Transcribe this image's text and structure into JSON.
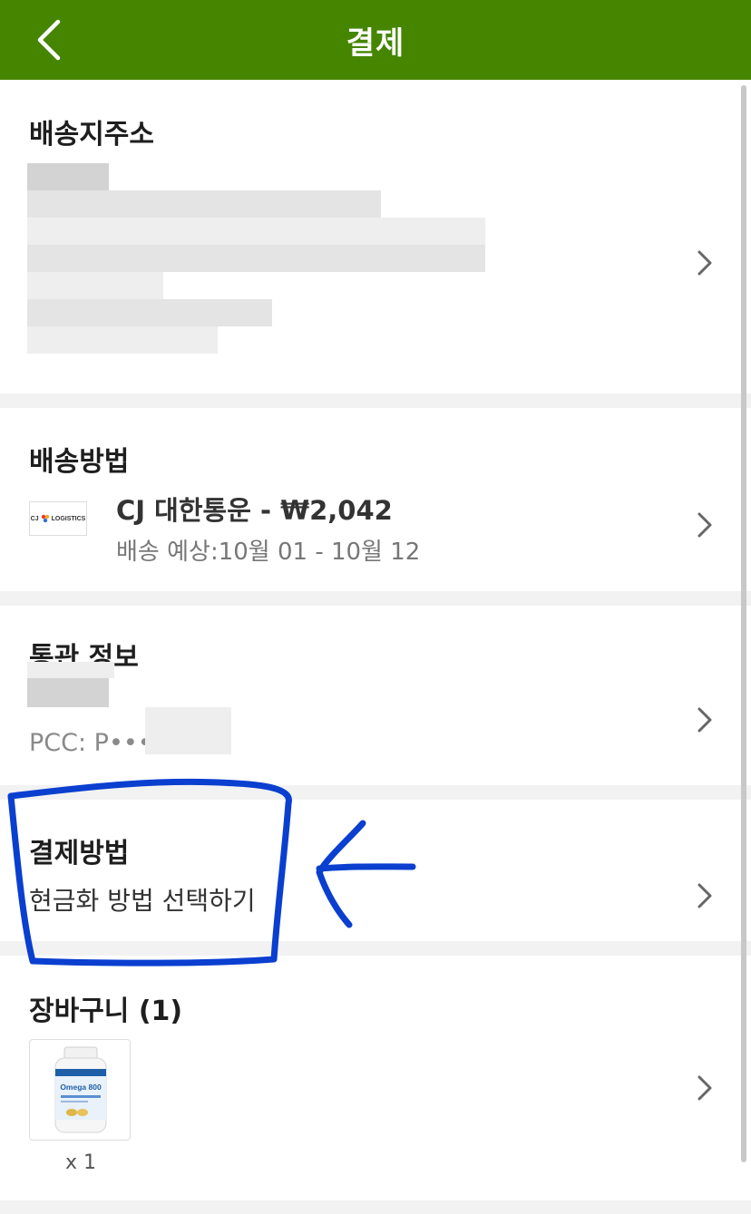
{
  "header": {
    "title": "결제",
    "back_icon": "chevron-left-icon",
    "background_color": "#458500"
  },
  "address": {
    "title": "배송지주소"
  },
  "shipping": {
    "title": "배송방법",
    "logo_text": "LOGISTICS",
    "logo_prefix": "CJ",
    "name": "CJ 대한통운 - ₩2,042",
    "eta": "배송 예상:10월 01 - 10월 12"
  },
  "customs": {
    "title": "통관 정보",
    "pcc": "PCC: P•••"
  },
  "payment": {
    "title": "결제방법",
    "subtitle": "현금화 방법 선택하기"
  },
  "cart": {
    "title": "장바구니 (1)",
    "product_label": "Omega 800",
    "quantity": "x 1"
  },
  "annotation": {
    "color": "#0a3fcf"
  }
}
